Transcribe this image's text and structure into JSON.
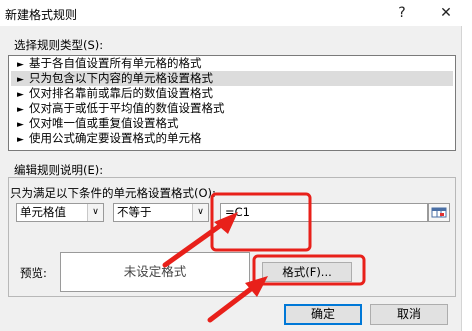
{
  "dialog": {
    "title": "新建格式规则",
    "help_label": "?",
    "close_label": "✕"
  },
  "rule_type": {
    "label": "选择规则类型(S):",
    "items": [
      {
        "label": "基于各自值设置所有单元格的格式"
      },
      {
        "label": "只为包含以下内容的单元格设置格式"
      },
      {
        "label": "仅对排名靠前或靠后的数值设置格式"
      },
      {
        "label": "仅对高于或低于平均值的数值设置格式"
      },
      {
        "label": "仅对唯一值或重复值设置格式"
      },
      {
        "label": "使用公式确定要设置格式的单元格"
      }
    ],
    "selected_index": 1,
    "bullet": "►"
  },
  "description": {
    "label": "编辑规则说明(E):",
    "condition_label": "只为满足以下条件的单元格设置格式(O):",
    "field1": "单元格值",
    "field2": "不等于",
    "value": "=C1"
  },
  "preview": {
    "label": "预览:",
    "text": "未设定格式",
    "format_button": "格式(F)..."
  },
  "buttons": {
    "ok": "确定",
    "cancel": "取消"
  },
  "colors": {
    "annotation": "#e8201a",
    "ok_border": "#0078d7"
  }
}
